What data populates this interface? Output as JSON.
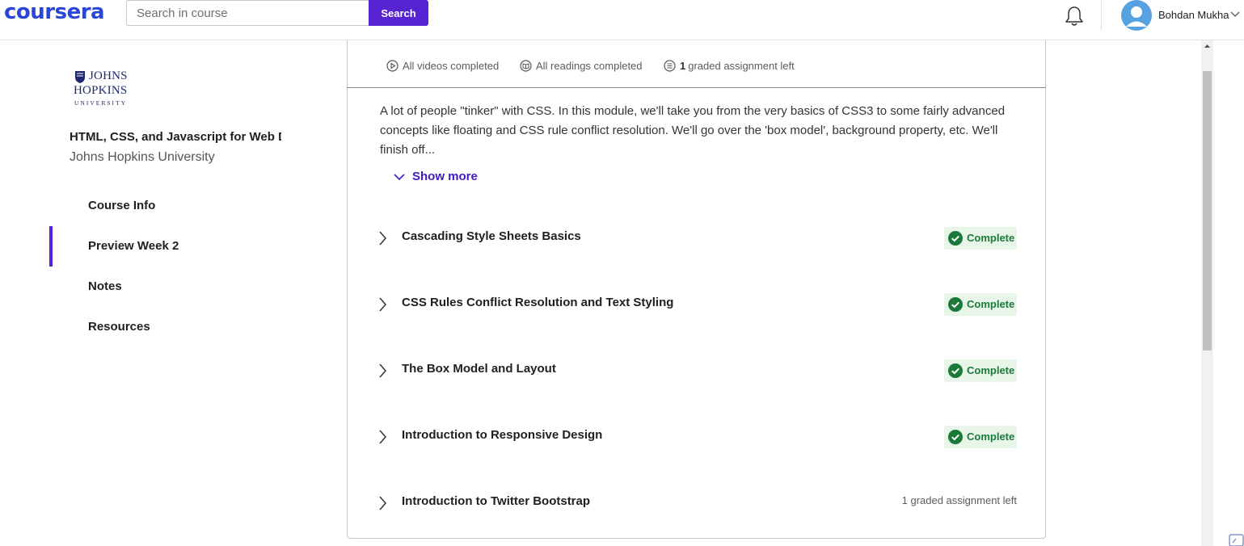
{
  "header": {
    "logo": "coursera",
    "search_placeholder": "Search in course",
    "search_button": "Search",
    "user_name": "Bohdan Mukha"
  },
  "sidebar": {
    "university_logo_lines": [
      "JOHNS",
      "HOPKINS",
      "UNIVERSITY"
    ],
    "course_title": "HTML, CSS, and Javascript for Web Developers",
    "course_org": "Johns Hopkins University",
    "nav": [
      {
        "label": "Course Info",
        "active": false
      },
      {
        "label": "Preview Week 2",
        "active": true
      },
      {
        "label": "Notes",
        "active": false
      },
      {
        "label": "Resources",
        "active": false
      }
    ]
  },
  "stats": {
    "videos": "All videos completed",
    "readings": "All readings completed",
    "graded_count": "1",
    "graded_text": "graded assignment left"
  },
  "description": "A lot of people \"tinker\" with CSS. In this module, we'll take you from the very basics of CSS3 to some fairly advanced concepts like floating and CSS rule conflict resolution. We'll go over the 'box model', background property, etc. We'll finish off...",
  "show_more": "Show more",
  "modules": [
    {
      "title": "Cascading Style Sheets Basics",
      "status": "Complete"
    },
    {
      "title": "CSS Rules Conflict Resolution and Text Styling",
      "status": "Complete"
    },
    {
      "title": "The Box Model and Layout",
      "status": "Complete"
    },
    {
      "title": "Introduction to Responsive Design",
      "status": "Complete"
    },
    {
      "title": "Introduction to Twitter Bootstrap",
      "status": "1 graded assignment left"
    }
  ],
  "colors": {
    "brand": "#2a46d6",
    "accent": "#5624d0",
    "complete_bg": "#e8f5e9",
    "complete_text": "#1b7a3a"
  },
  "icons": {
    "bell": "bell-icon",
    "avatar": "user-avatar-icon",
    "videos": "play-circle-icon",
    "readings": "book-icon",
    "graded": "assignment-icon",
    "module_toggle": "chevron-right-icon",
    "complete": "check-circle-icon"
  }
}
